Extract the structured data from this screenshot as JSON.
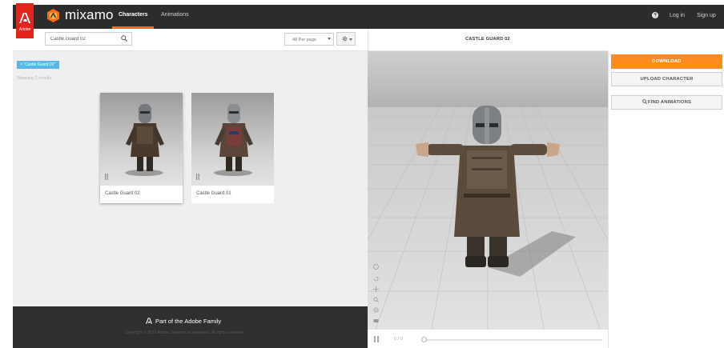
{
  "header": {
    "adobe_label": "Adobe",
    "app_name": "mixamo",
    "tabs": [
      {
        "label": "Characters",
        "active": true
      },
      {
        "label": "Animations",
        "active": false
      }
    ],
    "login_label": "Log in",
    "signup_label": "Sign up",
    "help_icon": "help-circle-icon",
    "accent_color": "#ff6a13"
  },
  "search": {
    "value": "Castle Guard 02",
    "per_page": "48 Per page"
  },
  "results": {
    "filter_tag": "× \"Castle Guard 02\"",
    "count_text": "Showing 2 results",
    "cards": [
      {
        "label": "Castle Guard 02"
      },
      {
        "label": "Castle Guard 01"
      }
    ]
  },
  "footer": {
    "brand_text": "Part of the Adobe Family",
    "copyright": "Copyright © 2016 Adobe Systems Incorporated. All rights reserved."
  },
  "viewer": {
    "title": "CASTLE GUARD 02",
    "frame_counter": "0 / 0"
  },
  "actions": {
    "download": "DOWNLOAD",
    "upload": "UPLOAD CHARACTER",
    "find_animations": "FIND ANIMATIONS",
    "download_color": "#ff8b1f"
  }
}
